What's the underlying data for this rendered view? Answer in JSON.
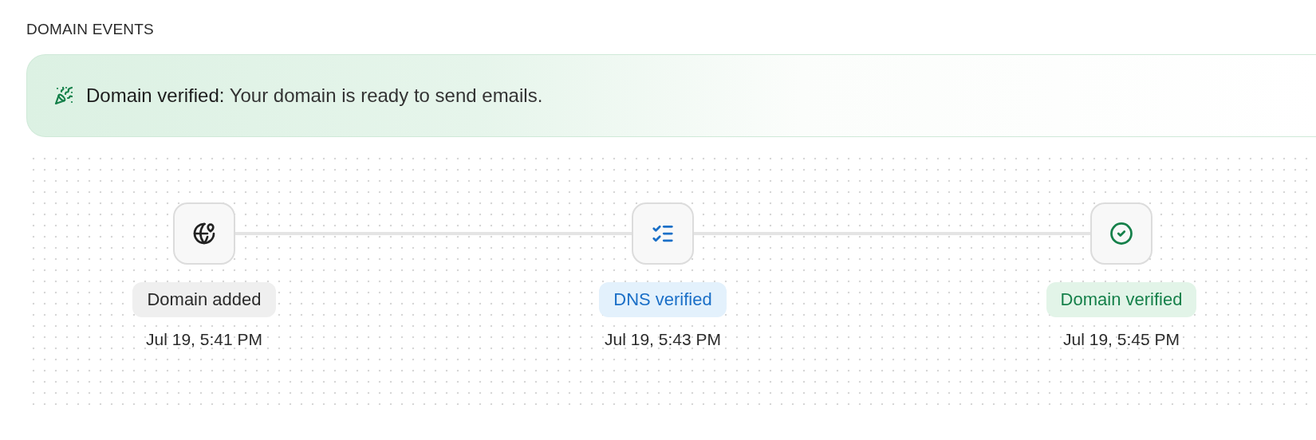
{
  "section_title": "DOMAIN EVENTS",
  "banner": {
    "kind": "success",
    "label": "Domain verified:",
    "message": "Your domain is ready to send emails."
  },
  "events": [
    {
      "kind": "added",
      "label": "Domain added",
      "time": "Jul 19, 5:41 PM"
    },
    {
      "kind": "dns",
      "label": "DNS verified",
      "time": "Jul 19, 5:43 PM"
    },
    {
      "kind": "verified",
      "label": "Domain verified",
      "time": "Jul 19, 5:45 PM"
    }
  ]
}
